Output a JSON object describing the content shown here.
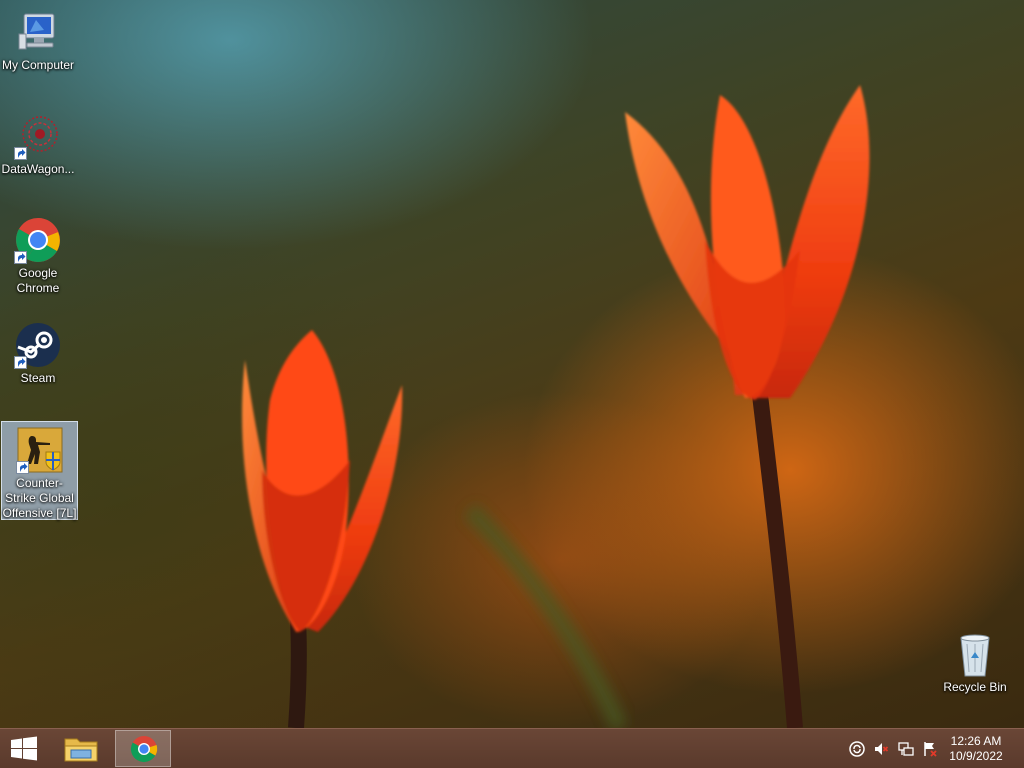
{
  "desktop": {
    "icons": [
      {
        "label": "My Computer"
      },
      {
        "label": "DataWagon..."
      },
      {
        "label": "Google Chrome"
      },
      {
        "label": "Steam"
      },
      {
        "label": "Counter-Strike Global Offensive [7L]"
      },
      {
        "label": "Recycle Bin"
      }
    ]
  },
  "taskbar": {
    "pinned": [
      "file-explorer-icon",
      "chrome-icon"
    ],
    "tray_icons": [
      "sync-icon",
      "volume-muted-icon",
      "network-icon",
      "action-center-flag-icon"
    ],
    "clock": {
      "time": "12:26 AM",
      "date": "10/9/2022"
    }
  },
  "colors": {
    "taskbar": "#5e3e30",
    "selection": "#aabed7",
    "tulip": "#ff4a14"
  }
}
